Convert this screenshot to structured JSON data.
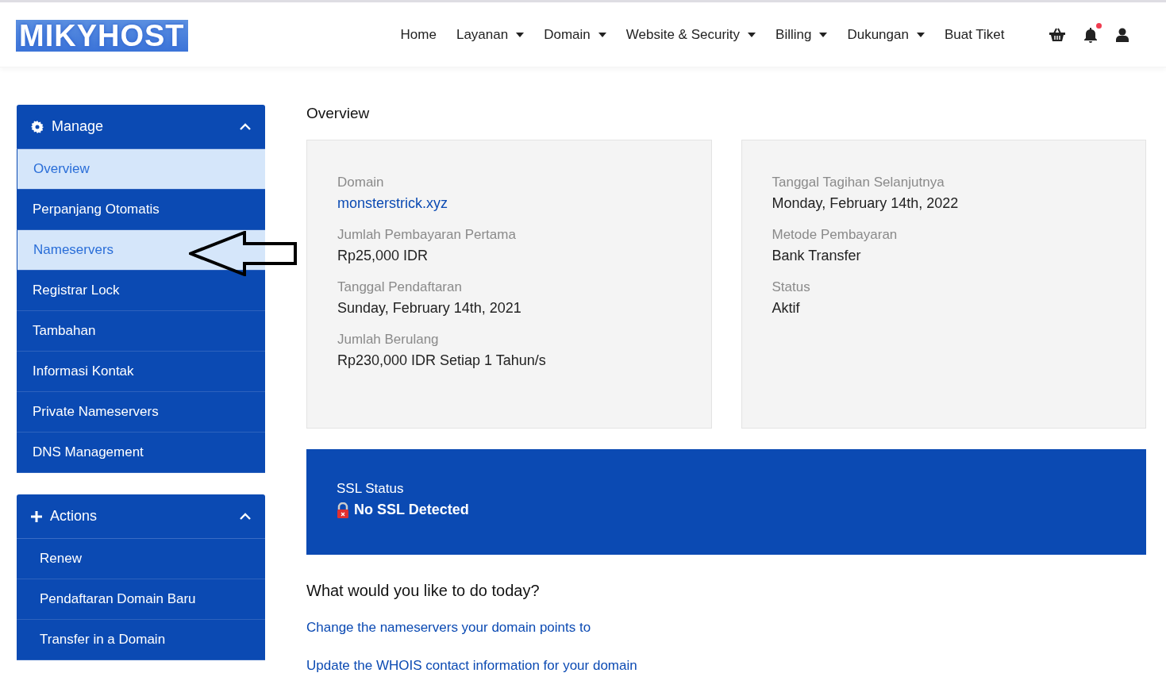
{
  "logo": {
    "text": "MIKYHOST"
  },
  "nav": [
    {
      "label": "Home",
      "dropdown": false
    },
    {
      "label": "Layanan",
      "dropdown": true
    },
    {
      "label": "Domain",
      "dropdown": true
    },
    {
      "label": "Website & Security",
      "dropdown": true
    },
    {
      "label": "Billing",
      "dropdown": true
    },
    {
      "label": "Dukungan",
      "dropdown": true
    },
    {
      "label": "Buat Tiket",
      "dropdown": false
    }
  ],
  "notifications": {
    "unread": true
  },
  "sidebar": [
    {
      "kind": "manage",
      "title": "Manage",
      "expanded": true,
      "items": [
        {
          "label": "Overview",
          "selected": true
        },
        {
          "label": "Perpanjang Otomatis",
          "selected": false
        },
        {
          "label": "Nameservers",
          "selected": true
        },
        {
          "label": "Registrar Lock",
          "selected": false
        },
        {
          "label": "Tambahan",
          "selected": false
        },
        {
          "label": "Informasi Kontak",
          "selected": false
        },
        {
          "label": "Private Nameservers",
          "selected": false
        },
        {
          "label": "DNS Management",
          "selected": false
        }
      ]
    },
    {
      "kind": "actions",
      "title": "Actions",
      "expanded": true,
      "items": [
        {
          "label": "Renew",
          "selected": false
        },
        {
          "label": "Pendaftaran Domain Baru",
          "selected": false
        },
        {
          "label": "Transfer in a Domain",
          "selected": false
        }
      ]
    }
  ],
  "overview": {
    "title": "Overview",
    "cards": [
      [
        {
          "label": "Domain",
          "value": "monsterstrick.xyz",
          "link": true
        },
        {
          "label": "Jumlah Pembayaran Pertama",
          "value": "Rp25,000 IDR",
          "link": false
        },
        {
          "label": "Tanggal Pendaftaran",
          "value": "Sunday, February 14th, 2021",
          "link": false
        },
        {
          "label": "Jumlah Berulang",
          "value": "Rp230,000 IDR Setiap 1 Tahun/s",
          "link": false
        }
      ],
      [
        {
          "label": "Tanggal Tagihan Selanjutnya",
          "value": "Monday, February 14th, 2022",
          "link": false
        },
        {
          "label": "Metode Pembayaran",
          "value": "Bank Transfer",
          "link": false
        },
        {
          "label": "Status",
          "value": "Aktif",
          "link": false
        }
      ]
    ],
    "ssl": {
      "label": "SSL Status",
      "value": "No SSL Detected",
      "secure": false
    }
  },
  "actions": {
    "title": "What would you like to do today?",
    "links": [
      "Change the nameservers your domain points to",
      "Update the WHOIS contact information for your domain"
    ]
  }
}
